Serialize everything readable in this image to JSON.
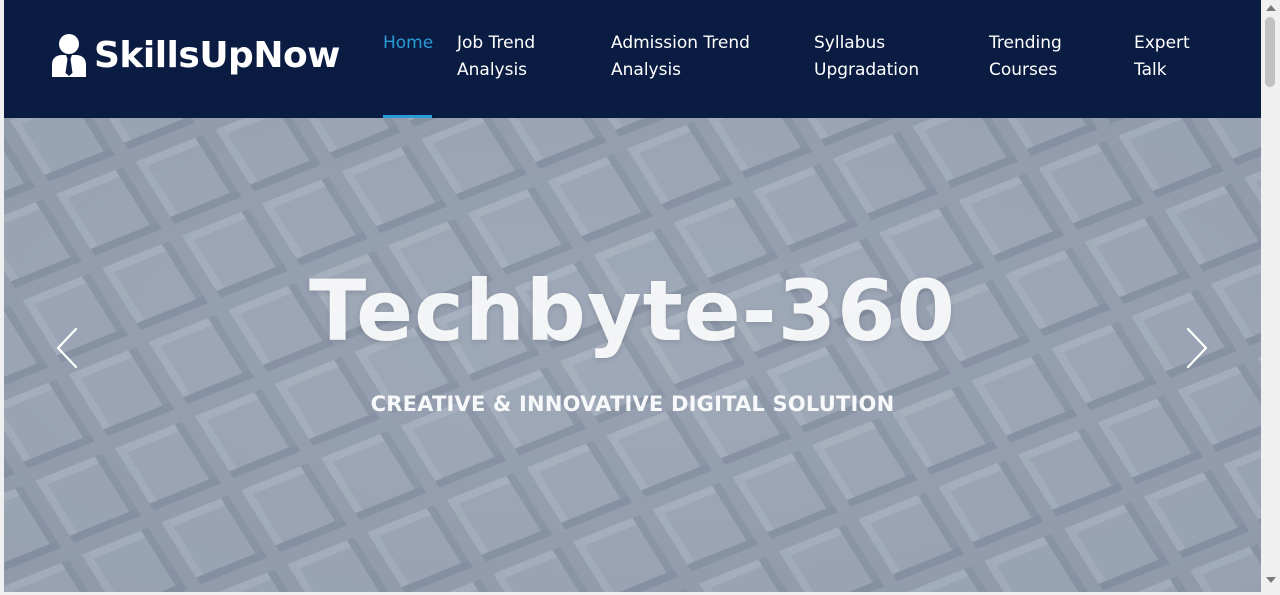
{
  "brand": {
    "name": "SkillsUpNow",
    "logo_icon": "user-tie-icon"
  },
  "nav": {
    "items": [
      {
        "label": "Home",
        "active": true
      },
      {
        "label_line1": "Job Trend",
        "label_line2": "Analysis"
      },
      {
        "label_line1": "Admission Trend",
        "label_line2": "Analysis"
      },
      {
        "label_line1": "Syllabus",
        "label_line2": "Upgradation"
      },
      {
        "label_line1": "Trending",
        "label_line2": "Courses"
      },
      {
        "label_line1": "Expert",
        "label_line2": "Talk"
      }
    ]
  },
  "hero": {
    "title": "Techbyte-360",
    "subtitle": "CREATIVE & INNOVATIVE DIGITAL SOLUTION",
    "prev_icon": "chevron-left-icon",
    "next_icon": "chevron-right-icon"
  },
  "colors": {
    "navbar_bg": "#0b1c43",
    "active_link": "#2b9bd8",
    "hero_bg": "#8e99aa"
  }
}
